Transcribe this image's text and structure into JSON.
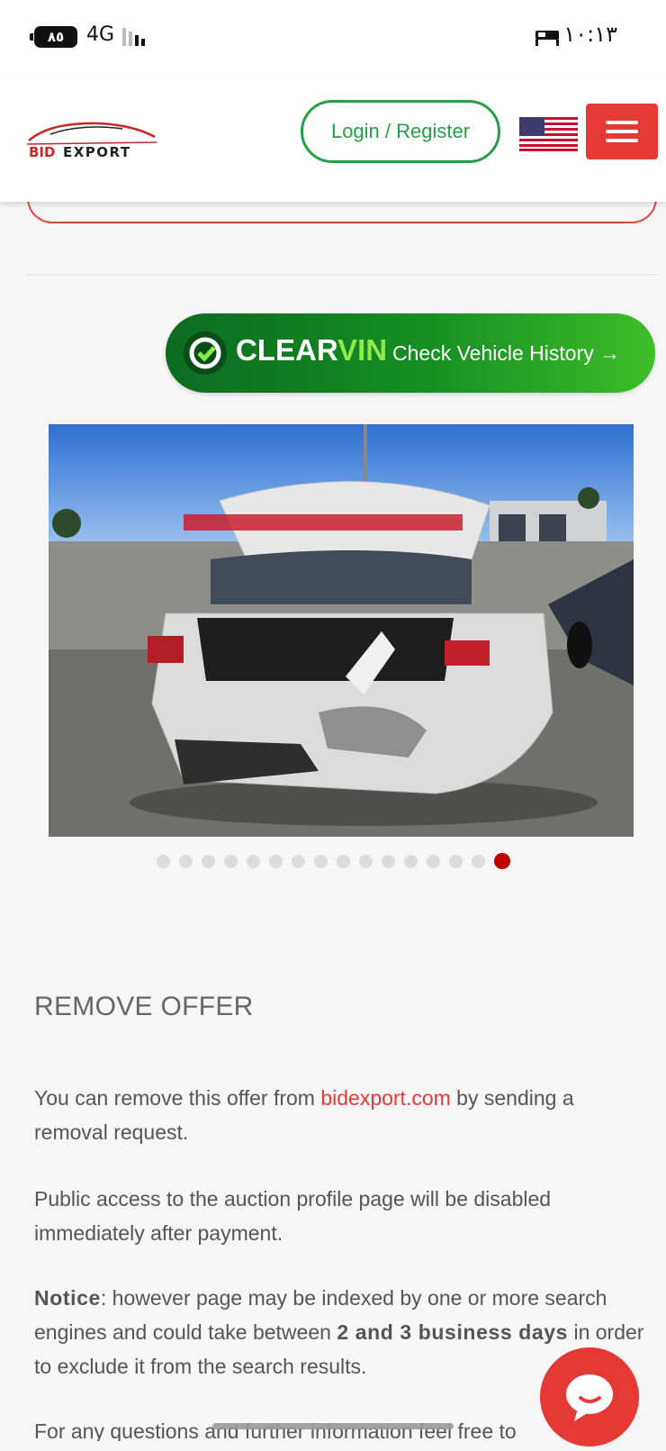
{
  "status_bar": {
    "battery": "٨٥",
    "network": "4G",
    "time": "١٠:١٣"
  },
  "header": {
    "logo_text": "BID EXPORT",
    "login_label": "Login / Register",
    "flag": "us-flag-icon",
    "menu": "hamburger-menu-icon"
  },
  "clearvin": {
    "brand_a": "CLEAR",
    "brand_b": "VIN",
    "tagline": "Check Vehicle History →"
  },
  "carousel": {
    "total": 16,
    "active": 16
  },
  "remove_offer": {
    "title": "REMOVE OFFER",
    "p1_before": "You can remove this offer from ",
    "p1_link": "bidexport.com",
    "p1_after": " by sending a removal request.",
    "p2": "Public access to the auction profile page will be disabled immediately after payment.",
    "notice_label": "Notice",
    "p3_a": ": however page may be indexed by one or more search engines and could take between ",
    "p3_bold": "2 and 3 business days",
    "p3_b": " in order to exclude it from the search results.",
    "p4": "For any questions and further information feel free to"
  },
  "colors": {
    "brand_red": "#e53935",
    "brand_green": "#26a046",
    "dot_active": "#c00000"
  }
}
